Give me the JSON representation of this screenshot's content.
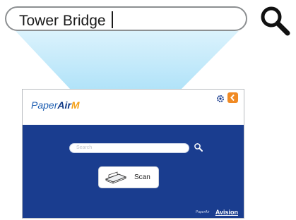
{
  "callout": {
    "query": "Tower Bridge",
    "search_icon": "magnifier-icon"
  },
  "app": {
    "logo": {
      "part1": "Paper",
      "part2": "Air",
      "part3": "M"
    },
    "settings_icon": "gear-icon",
    "back_icon": "chevron-left-icon",
    "search_placeholder": "Search",
    "scan_label": "Scan",
    "footer_brand": "Avision",
    "footer_sub": "PaperAir"
  },
  "colors": {
    "panel": "#1a3d8f",
    "accent": "#f08a24",
    "cone": "#8fd3f5"
  }
}
